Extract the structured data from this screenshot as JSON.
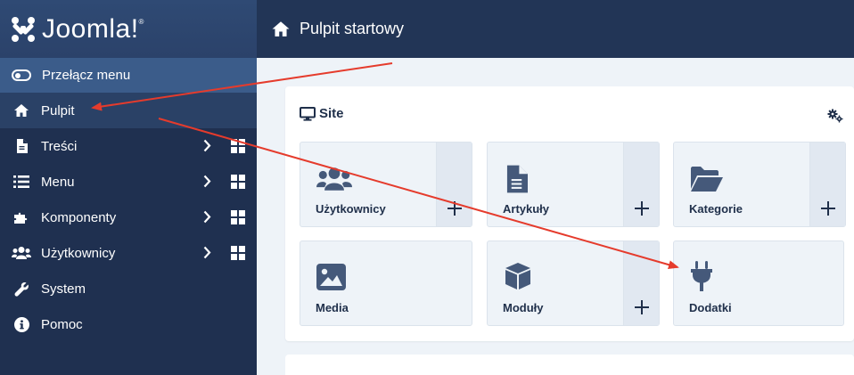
{
  "brand": {
    "name": "Joomla!",
    "mark": "®"
  },
  "sidebar": {
    "toggle_label": "Przełącz menu",
    "items": [
      {
        "label": "Pulpit",
        "icon": "home-icon"
      },
      {
        "label": "Treści",
        "icon": "file-icon"
      },
      {
        "label": "Menu",
        "icon": "list-icon"
      },
      {
        "label": "Komponenty",
        "icon": "puzzle-icon"
      },
      {
        "label": "Użytkownicy",
        "icon": "users-icon"
      },
      {
        "label": "System",
        "icon": "wrench-icon"
      },
      {
        "label": "Pomoc",
        "icon": "info-icon"
      }
    ]
  },
  "header": {
    "title": "Pulpit startowy",
    "icon": "home-icon"
  },
  "site_panel": {
    "title": "Site",
    "tiles": [
      {
        "label": "Użytkownicy",
        "icon": "users-icon",
        "has_add": true
      },
      {
        "label": "Artykuły",
        "icon": "file-icon",
        "has_add": true
      },
      {
        "label": "Kategorie",
        "icon": "folder-open-icon",
        "has_add": true
      },
      {
        "label": "Media",
        "icon": "image-icon",
        "has_add": false
      },
      {
        "label": "Moduły",
        "icon": "cube-icon",
        "has_add": true
      },
      {
        "label": "Dodatki",
        "icon": "plug-icon",
        "has_add": false
      }
    ]
  },
  "colors": {
    "sidebar": "#1f3050",
    "topbar": "#223556",
    "accent": "#3b5c8a",
    "annotation_arrow": "#e53b2c"
  }
}
